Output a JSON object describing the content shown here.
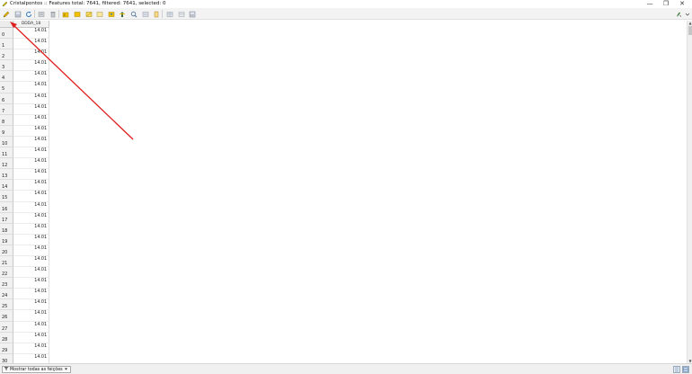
{
  "window": {
    "title": "Cristalpontos :: Features total: 7641, filtered: 7641, selected: 0",
    "minimize": "—",
    "maximize": "❐",
    "close": "✕"
  },
  "toolbar": {
    "buttons": [
      "toggle-editing",
      "save-edits",
      "reload",
      "add-feature",
      "delete-feature",
      "select-by-expression",
      "select-all",
      "invert-selection",
      "deselect-all",
      "filter-select",
      "move-selection-top",
      "pan-to-selection",
      "zoom-to-selection",
      "copy",
      "paste",
      "new-field",
      "delete-field",
      "field-calculator",
      "conditional-formatting",
      "dock"
    ]
  },
  "table": {
    "column_header": "DDDA_18",
    "rows": [
      {
        "id": "0",
        "value": "14.01"
      },
      {
        "id": "1",
        "value": "14.01"
      },
      {
        "id": "2",
        "value": "14.01"
      },
      {
        "id": "3",
        "value": "14.01"
      },
      {
        "id": "4",
        "value": "14.01"
      },
      {
        "id": "5",
        "value": "14.01"
      },
      {
        "id": "6",
        "value": "14.01"
      },
      {
        "id": "7",
        "value": "14.01"
      },
      {
        "id": "8",
        "value": "14.01"
      },
      {
        "id": "9",
        "value": "14.01"
      },
      {
        "id": "10",
        "value": "14.01"
      },
      {
        "id": "11",
        "value": "14.01"
      },
      {
        "id": "12",
        "value": "14.01"
      },
      {
        "id": "13",
        "value": "14.01"
      },
      {
        "id": "14",
        "value": "14.01"
      },
      {
        "id": "15",
        "value": "14.01"
      },
      {
        "id": "16",
        "value": "14.01"
      },
      {
        "id": "17",
        "value": "14.01"
      },
      {
        "id": "18",
        "value": "14.01"
      },
      {
        "id": "19",
        "value": "14.01"
      },
      {
        "id": "20",
        "value": "14.01"
      },
      {
        "id": "21",
        "value": "14.01"
      },
      {
        "id": "22",
        "value": "14.01"
      },
      {
        "id": "23",
        "value": "14.01"
      },
      {
        "id": "24",
        "value": "14.01"
      },
      {
        "id": "25",
        "value": "14.01"
      },
      {
        "id": "26",
        "value": "14.01"
      },
      {
        "id": "27",
        "value": "14.01"
      },
      {
        "id": "28",
        "value": "14.01"
      },
      {
        "id": "29",
        "value": "14.01"
      },
      {
        "id": "30",
        "value": "14.01"
      }
    ]
  },
  "bottom": {
    "filter_label": "Mostrar todas as feições"
  },
  "colors": {
    "annotation": "#e02020",
    "edit_icon": "#e8b400",
    "selection_icon": "#f2c200"
  }
}
